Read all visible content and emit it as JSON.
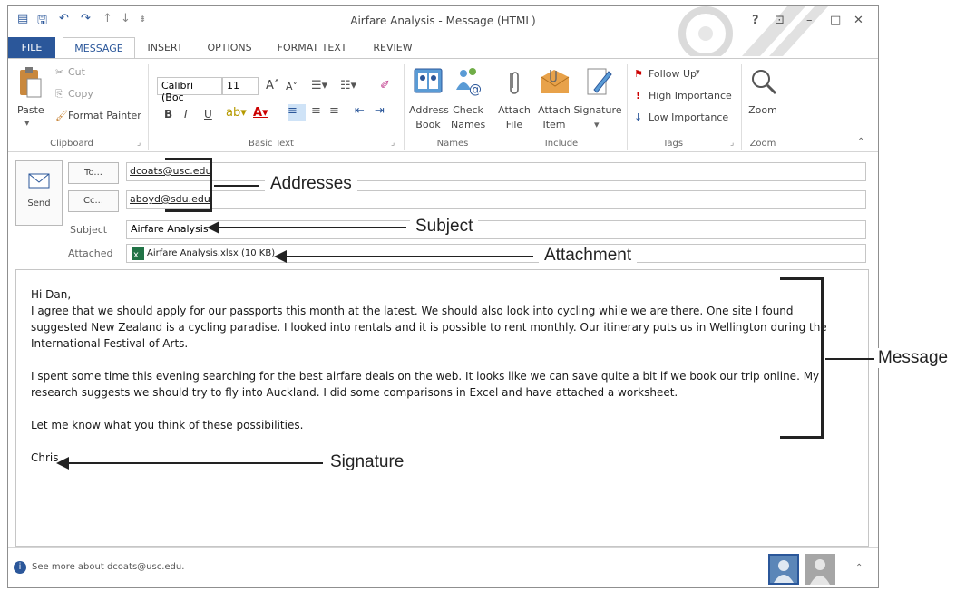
{
  "window": {
    "title": "Airfare Analysis - Message (HTML)",
    "help": "?",
    "controls": {
      "ribbon_options": "⊡",
      "minimize": "–",
      "maximize": "□",
      "close": "✕"
    }
  },
  "quick_access": {
    "save": "🖫",
    "undo": "↶",
    "redo": "↷",
    "up": "↑",
    "down": "↓",
    "more": "⇟"
  },
  "tabs": [
    "FILE",
    "MESSAGE",
    "INSERT",
    "OPTIONS",
    "FORMAT TEXT",
    "REVIEW"
  ],
  "ribbon": {
    "clipboard": {
      "paste": "Paste",
      "cut": "Cut",
      "copy": "Copy",
      "format_painter": "Format Painter",
      "group": "Clipboard"
    },
    "basic_text": {
      "font": "Calibri (Boc",
      "size": "11",
      "bold": "B",
      "italic": "I",
      "underline": "U",
      "group": "Basic Text"
    },
    "names": {
      "address_book_1": "Address",
      "address_book_2": "Book",
      "check_names_1": "Check",
      "check_names_2": "Names",
      "group": "Names"
    },
    "include": {
      "attach_file_1": "Attach",
      "attach_file_2": "File",
      "attach_item_1": "Attach",
      "attach_item_2": "Item",
      "signature": "Signature",
      "group": "Include"
    },
    "tags": {
      "follow_up": "Follow Up",
      "high": "High Importance",
      "low": "Low Importance",
      "group": "Tags"
    },
    "zoom": {
      "zoom": "Zoom",
      "group": "Zoom"
    }
  },
  "header": {
    "send": "Send",
    "to_label": "To...",
    "to_value": "dcoats@usc.edu",
    "cc_label": "Cc...",
    "cc_value": "aboyd@sdu.edu",
    "subject_label": "Subject",
    "subject_value": "Airfare Analysis",
    "attached_label": "Attached",
    "attachment": "Airfare Analysis.xlsx (10 KB)"
  },
  "message": {
    "greeting": "Hi Dan,",
    "para1": "I agree that we should apply for our passports this month at the latest. We should also look into cycling while we are there. One site I found suggested New Zealand is a cycling paradise. I looked into rentals and it is possible to rent monthly. Our itinerary puts us in Wellington during the International Festival of Arts.",
    "para2": "I spent some time this evening searching for the best airfare deals on the web. It looks like we can save quite a bit if we book our trip online. My research suggests we should try to fly into Auckland. I did some comparisons in Excel and have attached a worksheet.",
    "para3": "Let me know what you think of these possibilities.",
    "signature": "Chris"
  },
  "status": {
    "people": "See more about dcoats@usc.edu."
  },
  "callouts": {
    "addresses": "Addresses",
    "subject": "Subject",
    "attachment": "Attachment",
    "message": "Message",
    "signature": "Signature"
  }
}
